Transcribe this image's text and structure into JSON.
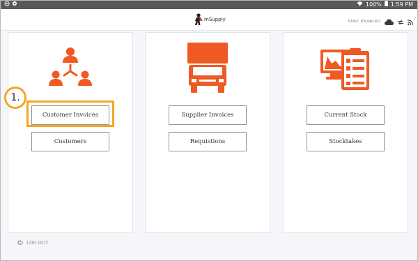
{
  "status_bar": {
    "battery": "100%",
    "time": "1:59 PM"
  },
  "app_bar": {
    "logo_text": "mSupply",
    "sync_status": "SYNC ENABLED"
  },
  "cards": {
    "customers": {
      "icon": "people-network-icon",
      "buttons": [
        "Customer Invoices",
        "Customers"
      ]
    },
    "suppliers": {
      "icon": "truck-icon",
      "buttons": [
        "Supplier Invoices",
        "Requistions"
      ]
    },
    "stock": {
      "icon": "stock-report-icon",
      "buttons": [
        "Current Stock",
        "Stocktakes"
      ]
    }
  },
  "annotation": {
    "step_number": "1."
  },
  "footer": {
    "logout_label": "LOG OUT"
  },
  "colors": {
    "accent": "#ef5a24",
    "highlight": "#f5a623",
    "status_bar": "#595959"
  }
}
